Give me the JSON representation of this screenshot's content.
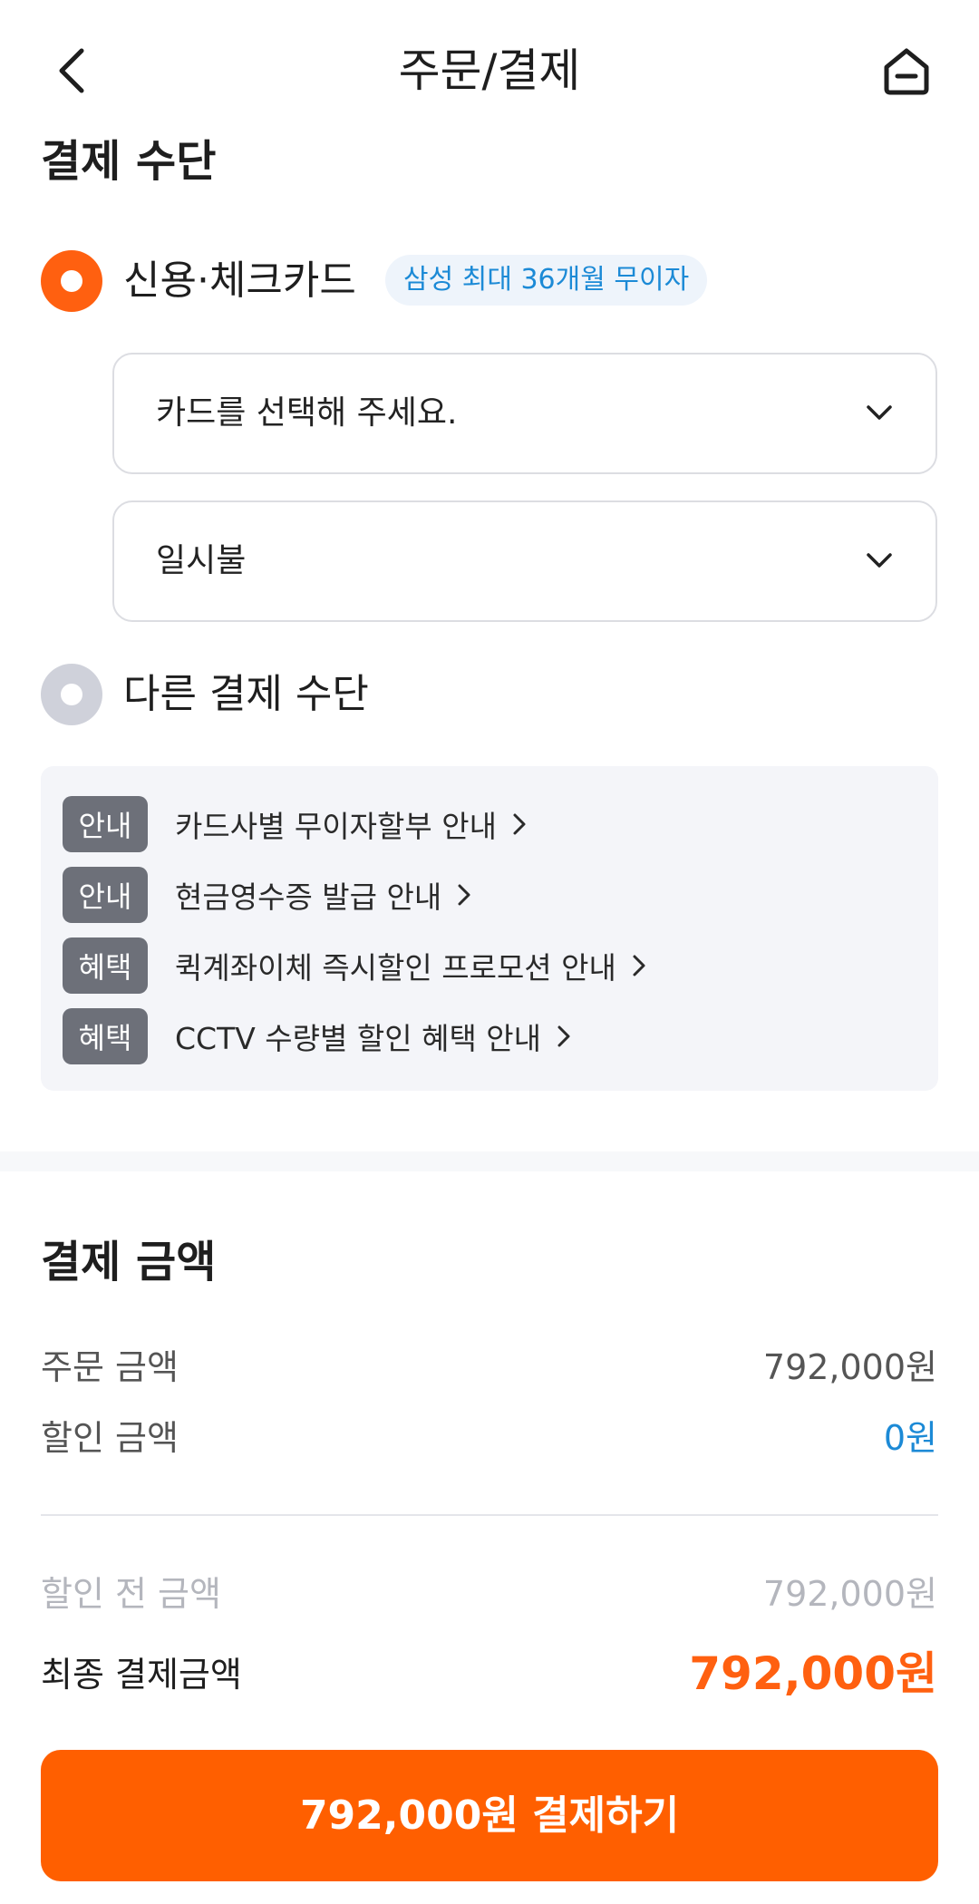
{
  "header": {
    "title": "주문/결제",
    "back_icon": "chevron-left-icon",
    "home_icon": "home-icon"
  },
  "payment_method": {
    "section_title": "결제 수단",
    "card_option": {
      "label": "신용·체크카드",
      "selected": true,
      "promo": "삼성 최대 36개월 무이자"
    },
    "card_select": {
      "value": "카드를 선택해 주세요."
    },
    "installment_select": {
      "value": "일시불"
    },
    "other_option": {
      "label": "다른 결제 수단",
      "selected": false
    }
  },
  "notices": [
    {
      "tag": "안내",
      "text": "카드사별 무이자할부 안내"
    },
    {
      "tag": "안내",
      "text": "현금영수증 발급 안내"
    },
    {
      "tag": "혜택",
      "text": "퀵계좌이체 즉시할인 프로모션 안내"
    },
    {
      "tag": "혜택",
      "text": "CCTV 수량별 할인 혜택 안내"
    }
  ],
  "amount": {
    "section_title": "결제 금액",
    "order_label": "주문 금액",
    "order_value": "792,000원",
    "discount_label": "할인 금액",
    "discount_value": "0원",
    "before_discount_label": "할인 전 금액",
    "before_discount_value": "792,000원",
    "final_label": "최종 결제금액",
    "final_value": "792,000원"
  },
  "pay_button": {
    "label": "792,000원 결제하기"
  },
  "colors": {
    "accent": "#ff5f00",
    "link_blue": "#1c8ad6",
    "tag_gray": "#6d7079"
  }
}
